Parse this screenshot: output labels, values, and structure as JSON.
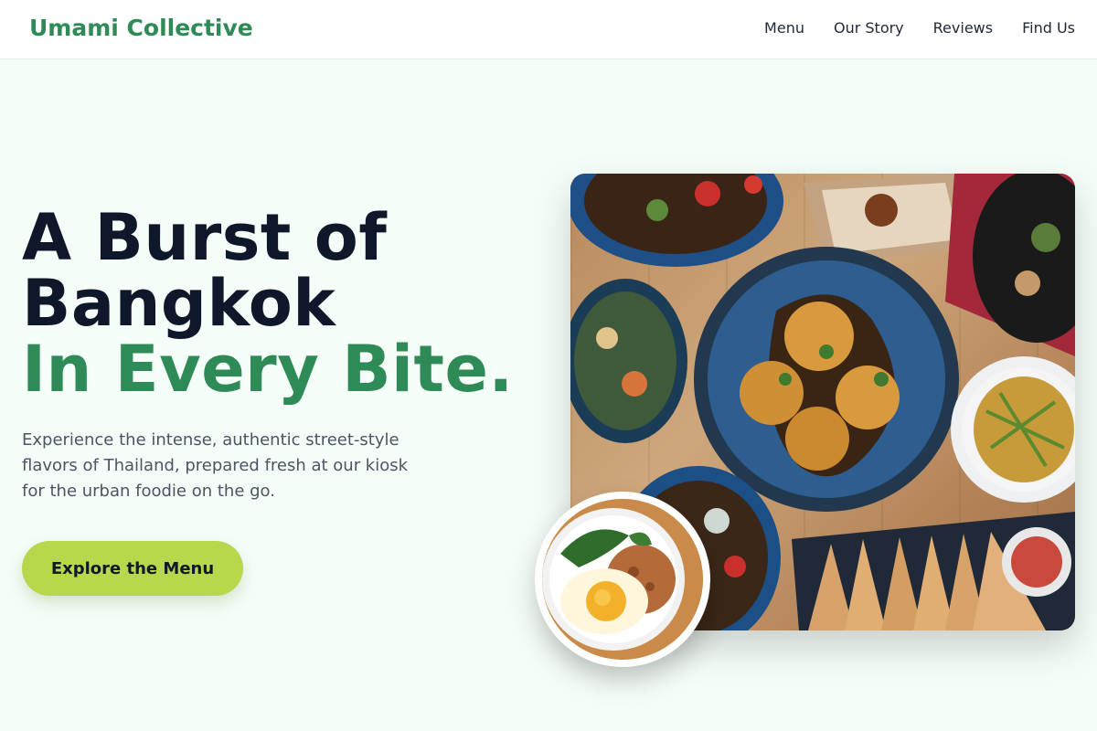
{
  "nav": {
    "brand": "Umami Collective",
    "links": [
      "Menu",
      "Our Story",
      "Reviews",
      "Find Us"
    ]
  },
  "hero": {
    "title_line1": "A Burst of",
    "title_line2": "Bangkok",
    "title_accent": "In Every Bite.",
    "description": "Experience the intense, authentic street-style flavors of Thailand, prepared fresh at our kiosk for the urban foodie on the go.",
    "cta_label": "Explore the Menu"
  },
  "colors": {
    "brand": "#2e8b57",
    "heading": "#0f172a",
    "cta_bg": "#b5d84d",
    "page_bg": "#f5fdf8"
  },
  "images": {
    "main": "thai-dishes-table-photo",
    "thumbnail": "basil-stir-fry-fried-egg-photo"
  }
}
